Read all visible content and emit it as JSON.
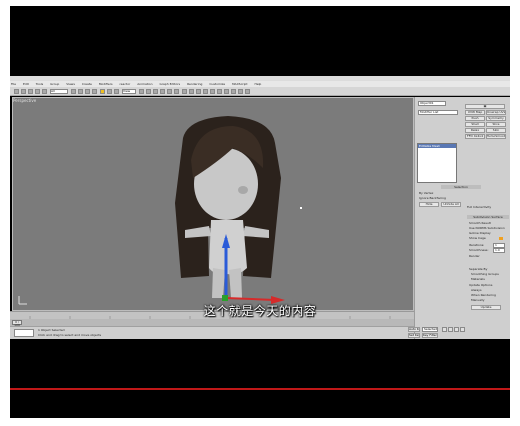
{
  "menu": {
    "items": [
      "File",
      "Edit",
      "Tools",
      "Group",
      "Views",
      "Create",
      "Modifiers",
      "reactor",
      "Animation",
      "Graph Editors",
      "Rendering",
      "Customize",
      "MAXScript",
      "Help"
    ]
  },
  "toolbar": {
    "selection_filter": "All",
    "view_dropdown": "View"
  },
  "viewport": {
    "label": "Perspective"
  },
  "command_panel": {
    "object_name": "Object01",
    "modifier_list": "Modifier List",
    "stack_item": "Editable Mesh",
    "buttons": [
      "UVW Map",
      "Unwrap UVW",
      "Push",
      "Symmetry",
      "Shell",
      "Slice",
      "Relax",
      "Skin",
      "FFD 4x4x4",
      "TurboSmooth"
    ],
    "selection_label": "Selection",
    "selection_options": [
      "By Vertex",
      "Ignore Backfacing",
      "Hide",
      "Unhide All"
    ],
    "full_interactivity": "Full Interactivity",
    "subdivision_label": "Subdivision Surface",
    "smooth_result": "Smooth Result",
    "use_nurms": "Use NURMS Subdivision",
    "isoline_display": "Isoline Display",
    "show_cage": "Show Cage",
    "iterations_label": "Iterations:",
    "iterations_value": "1",
    "smoothness_label": "Smoothness:",
    "smoothness_value": "1.0",
    "render_label": "Render",
    "separate_by": "Separate By",
    "smoothing_groups": "Smoothing Groups",
    "materials": "Materials",
    "update_options": "Update Options",
    "always": "Always",
    "when_rendering": "When Rendering",
    "manually": "Manually",
    "update_button": "Update"
  },
  "timeline": {
    "slider": "0 / 100"
  },
  "status": {
    "objects_selected": "1 Object Selected",
    "prompt": "Click and drag to select and move objects",
    "auto_key": "Auto Key",
    "set_key": "Set Key",
    "selected_dropdown": "Selected",
    "key_filters": "Key Filters..."
  },
  "subtitle": "这个就是今天的内容",
  "colors": {
    "frame": "#000000",
    "viewport_bg": "#7b7b7b",
    "ui_gray": "#cfcfcf",
    "accent_red": "#c01818",
    "gizmo_y": "#2a5bd8",
    "gizmo_x": "#d62a2a",
    "gizmo_z": "#2aa02a"
  }
}
